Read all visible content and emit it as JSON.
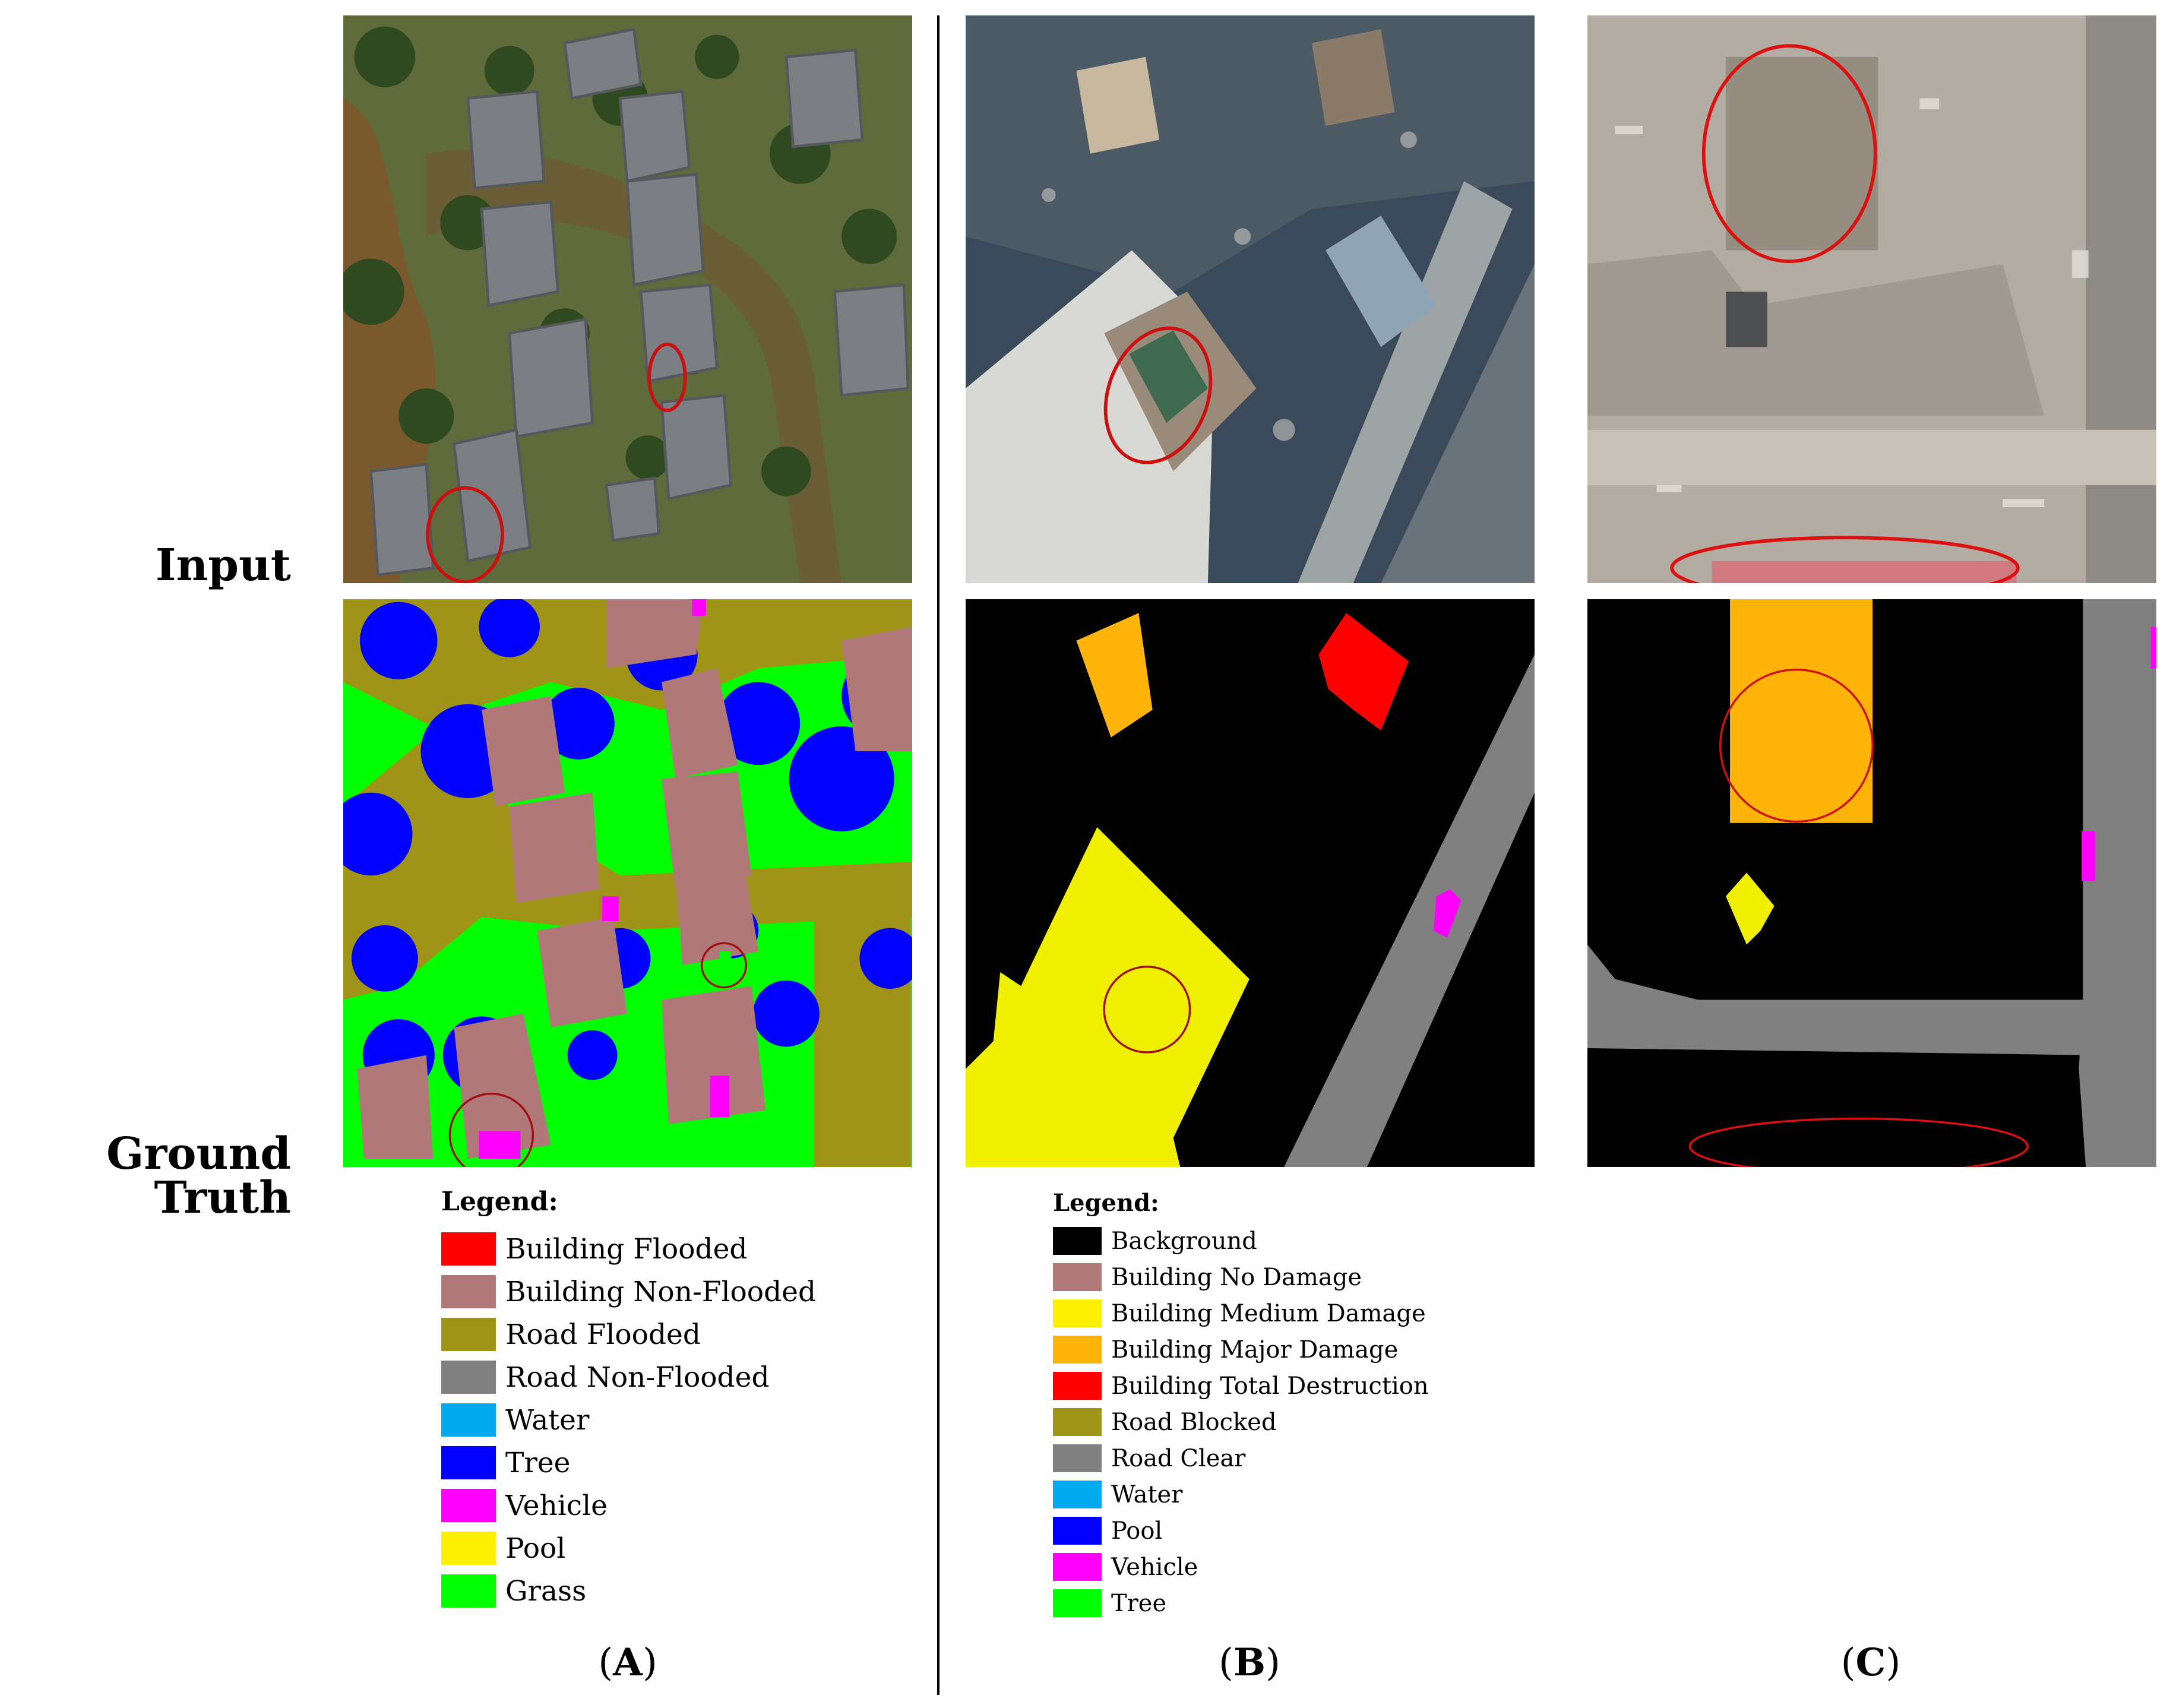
{
  "row_labels": {
    "input": "Input",
    "ground_truth": "Ground Truth"
  },
  "legend_a": {
    "title": "Legend:",
    "items": [
      {
        "label": "Building Flooded",
        "color": "#ff0000"
      },
      {
        "label": "Building Non-Flooded",
        "color": "#b07878"
      },
      {
        "label": "Road Flooded",
        "color": "#a09418"
      },
      {
        "label": "Road Non-Flooded",
        "color": "#808080"
      },
      {
        "label": "Water",
        "color": "#00aaee"
      },
      {
        "label": "Tree",
        "color": "#0000ff"
      },
      {
        "label": "Vehicle",
        "color": "#ff00ff"
      },
      {
        "label": "Pool",
        "color": "#fff000"
      },
      {
        "label": "Grass",
        "color": "#00ff00"
      }
    ]
  },
  "legend_b": {
    "title": "Legend:",
    "items": [
      {
        "label": "Background",
        "color": "#000000"
      },
      {
        "label": "Building No Damage",
        "color": "#b07878"
      },
      {
        "label": "Building Medium Damage",
        "color": "#fff000"
      },
      {
        "label": "Building Major Damage",
        "color": "#ffb40a"
      },
      {
        "label": "Building Total Destruction",
        "color": "#ff0000"
      },
      {
        "label": "Road Blocked",
        "color": "#a09418"
      },
      {
        "label": "Road Clear",
        "color": "#808080"
      },
      {
        "label": "Water",
        "color": "#00aaee"
      },
      {
        "label": "Pool",
        "color": "#0000ff"
      },
      {
        "label": "Vehicle",
        "color": "#ff00ff"
      },
      {
        "label": "Tree",
        "color": "#00ff00"
      }
    ]
  },
  "panel_labels": [
    {
      "open": "(",
      "letter": "A",
      "close": ")"
    },
    {
      "open": "(",
      "letter": "B",
      "close": ")"
    },
    {
      "open": "(",
      "letter": "C",
      "close": ")"
    }
  ]
}
